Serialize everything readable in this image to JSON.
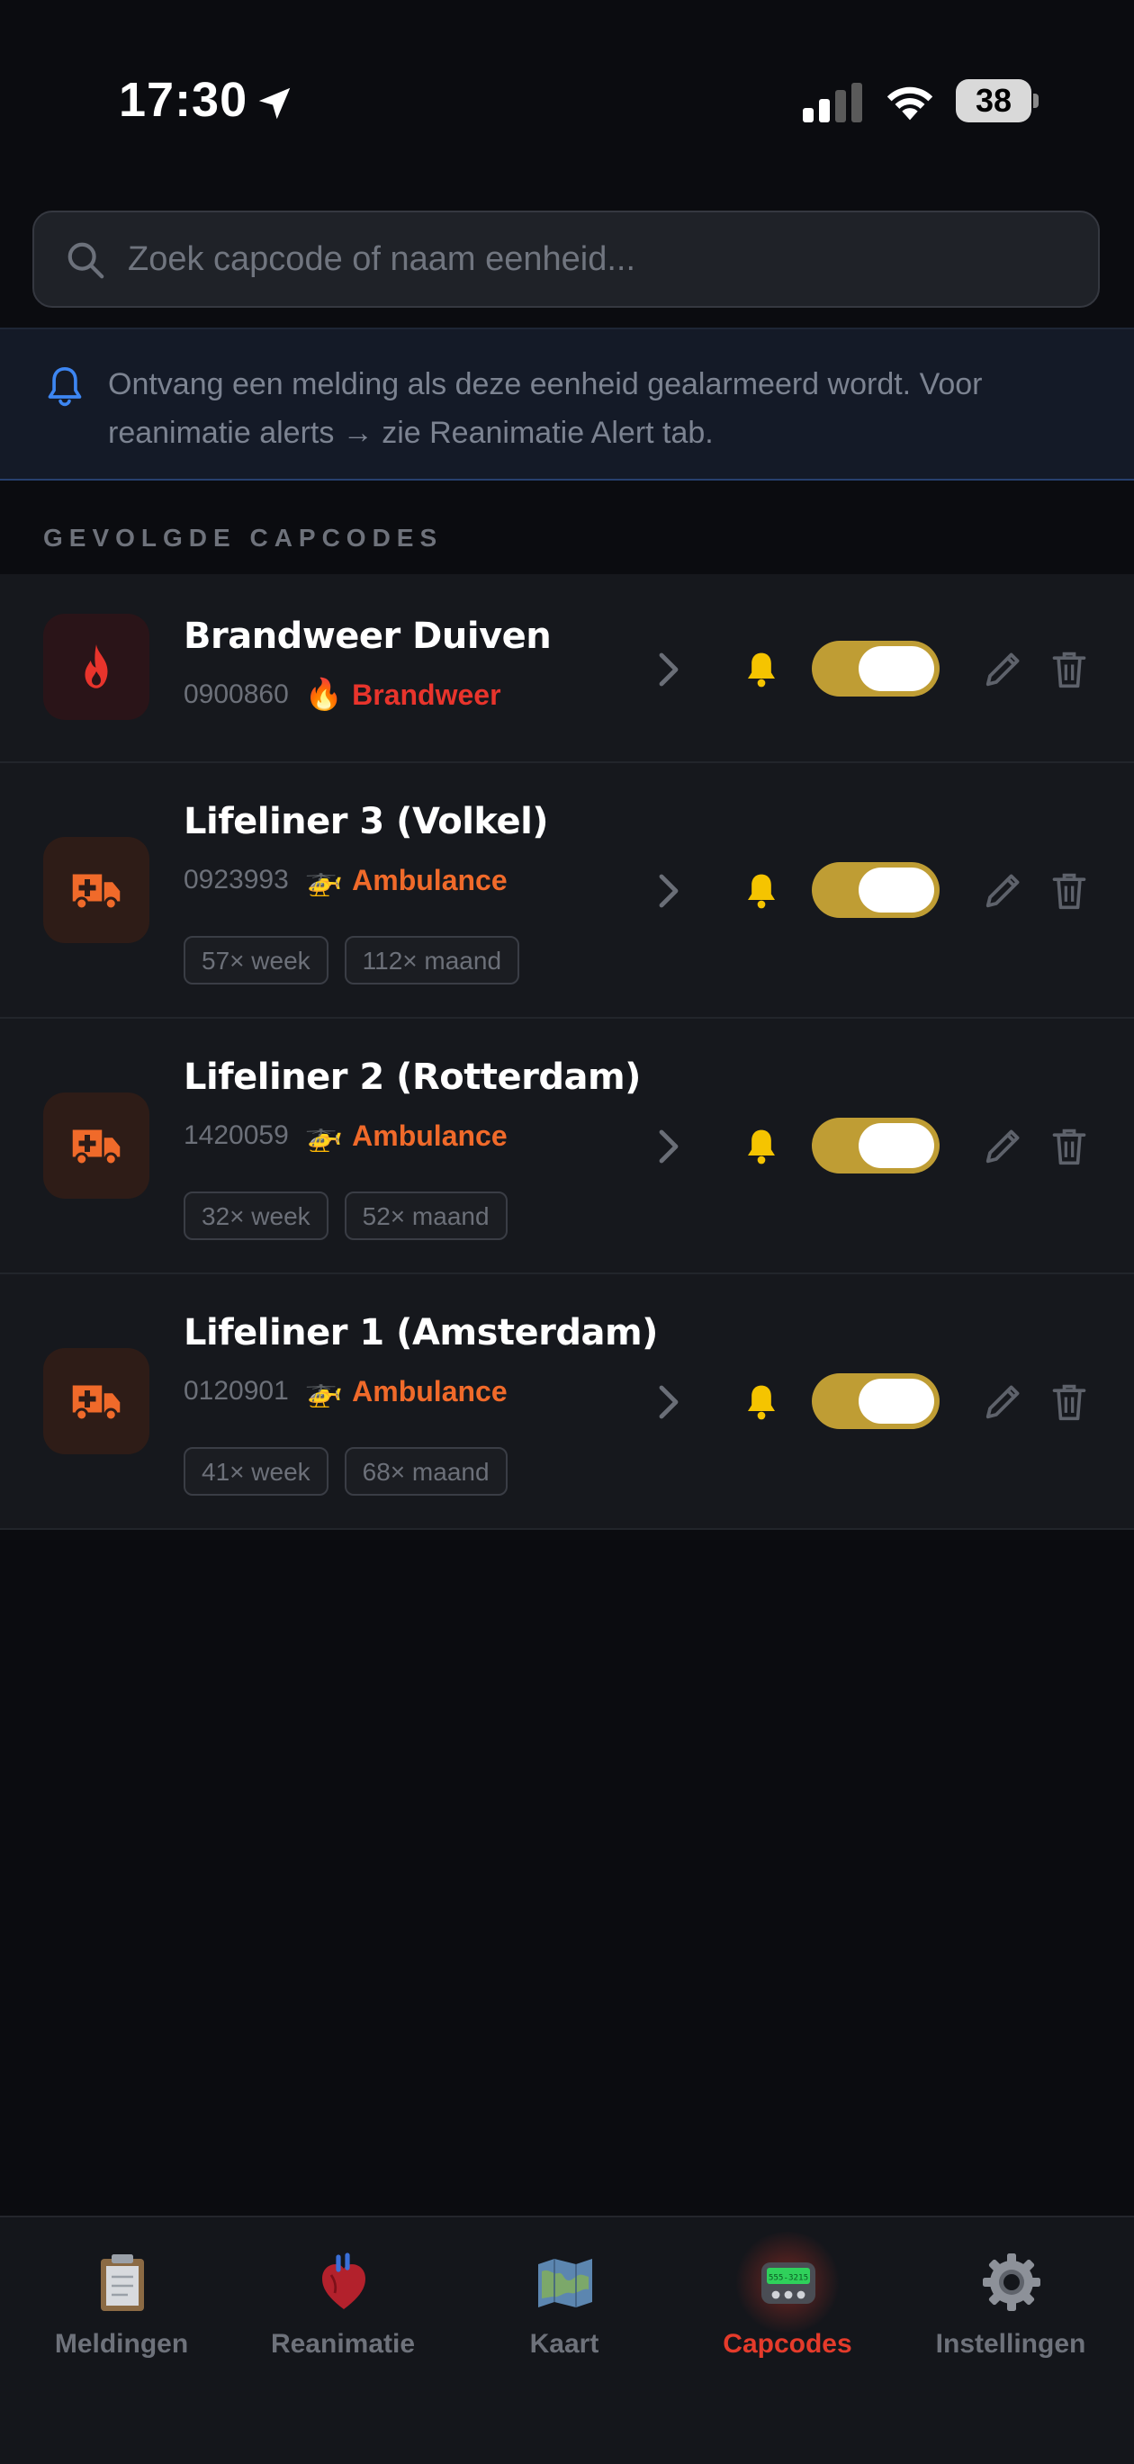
{
  "status_bar": {
    "time": "17:30",
    "battery": "38"
  },
  "search": {
    "placeholder": "Zoek capcode of naam eenheid..."
  },
  "info_banner": {
    "text": "Ontvang een melding als deze eenheid gealarmeerd wordt. Voor reanimatie alerts → zie Reanimatie Alert tab."
  },
  "section_title": "GEVOLGDE CAPCODES",
  "capcodes": [
    {
      "name": "Brandweer Duiven",
      "capcode": "0900860",
      "type_emoji": "🔥",
      "type": "Brandweer",
      "type_color": "#e8342c",
      "icon": "fire-icon",
      "enabled": true
    },
    {
      "name": "Lifeliner 3 (Volkel)",
      "capcode": "0923993",
      "type_emoji": "🚁",
      "type": "Ambulance",
      "type_color": "#f06a2a",
      "icon": "ambulance-icon",
      "week": "57× week",
      "month": "112× maand",
      "enabled": true
    },
    {
      "name": "Lifeliner 2 (Rotterdam)",
      "capcode": "1420059",
      "type_emoji": "🚁",
      "type": "Ambulance",
      "type_color": "#f06a2a",
      "icon": "ambulance-icon",
      "week": "32× week",
      "month": "52× maand",
      "enabled": true
    },
    {
      "name": "Lifeliner 1 (Amsterdam)",
      "capcode": "0120901",
      "type_emoji": "🚁",
      "type": "Ambulance",
      "type_color": "#f06a2a",
      "icon": "ambulance-icon",
      "week": "41× week",
      "month": "68× maand",
      "enabled": true
    }
  ],
  "colors": {
    "accent_red": "#e53b2b",
    "toggle_on": "#bf9d34",
    "bell": "#f5c400",
    "ambulance": "#f06a2a",
    "fire": "#e8342c"
  },
  "tabs": [
    {
      "label": "Meldingen",
      "icon": "clipboard-icon",
      "active": false
    },
    {
      "label": "Reanimatie",
      "icon": "heart-icon",
      "active": false
    },
    {
      "label": "Kaart",
      "icon": "map-icon",
      "active": false
    },
    {
      "label": "Capcodes",
      "icon": "pager-icon",
      "active": true
    },
    {
      "label": "Instellingen",
      "icon": "gear-icon",
      "active": false
    }
  ]
}
